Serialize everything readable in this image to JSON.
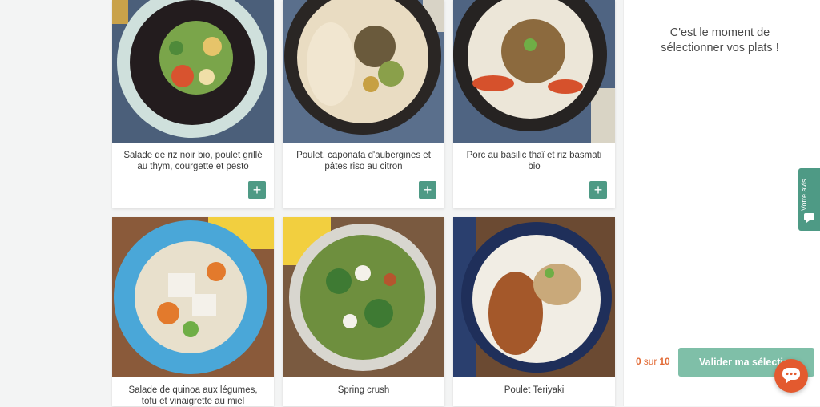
{
  "dishes": [
    {
      "title": "Salade de riz noir bio, poulet grillé au thym, courgette et pesto",
      "add_label": "+"
    },
    {
      "title": "Poulet, caponata d'aubergines et pâtes riso au citron",
      "add_label": "+"
    },
    {
      "title": "Porc au basilic thaï et riz basmati bio",
      "add_label": "+"
    },
    {
      "title": "Salade de quinoa aux légumes, tofu et vinaigrette au miel"
    },
    {
      "title": "Spring crush"
    },
    {
      "title": "Poulet Teriyaki"
    }
  ],
  "sidebar": {
    "prompt": "C'est le moment de sélectionner vos plats !",
    "count_selected": "0",
    "count_separator": "sur",
    "count_total": "10",
    "validate_label": "Valider ma sélection"
  },
  "feedback_tab": {
    "label": "Votre avis"
  },
  "colors": {
    "accent_green": "#4e9a85",
    "button_green_light": "#7fbfa8",
    "counter_orange": "#e26a35",
    "chat_orange": "#e35a2f"
  },
  "icons": {
    "add": "plus-icon",
    "feedback": "comment-icon",
    "chat": "chat-icon"
  }
}
